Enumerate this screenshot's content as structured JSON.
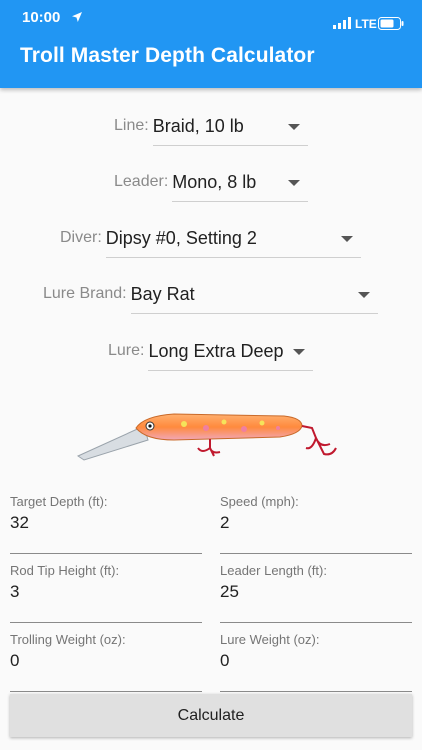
{
  "status_bar": {
    "time": "10:00",
    "network": "LTE"
  },
  "app": {
    "title": "Troll Master Depth Calculator"
  },
  "selectors": [
    {
      "label": "Line:",
      "value": "Braid, 10 lb"
    },
    {
      "label": "Leader:",
      "value": "Mono, 8 lb"
    },
    {
      "label": "Diver:",
      "value": "Dipsy #0, Setting 2"
    },
    {
      "label": "Lure Brand:",
      "value": "Bay Rat"
    },
    {
      "label": "Lure:",
      "value": "Long Extra Deep"
    }
  ],
  "fields": [
    {
      "label": "Target Depth (ft):",
      "value": "32"
    },
    {
      "label": "Speed (mph):",
      "value": "2"
    },
    {
      "label": "Rod Tip Height (ft):",
      "value": "3"
    },
    {
      "label": "Leader Length (ft):",
      "value": "25"
    },
    {
      "label": "Trolling Weight (oz):",
      "value": "0"
    },
    {
      "label": "Lure Weight (oz):",
      "value": "0"
    }
  ],
  "calculate_button": {
    "label": "Calculate"
  },
  "colors": {
    "app_bar": "#2196f3",
    "lure_body": "#ff8a3d",
    "hooks": "#c0192e"
  },
  "icons": {
    "location": "location-arrow-icon",
    "signal": "signal-bars-icon",
    "battery": "battery-icon"
  }
}
